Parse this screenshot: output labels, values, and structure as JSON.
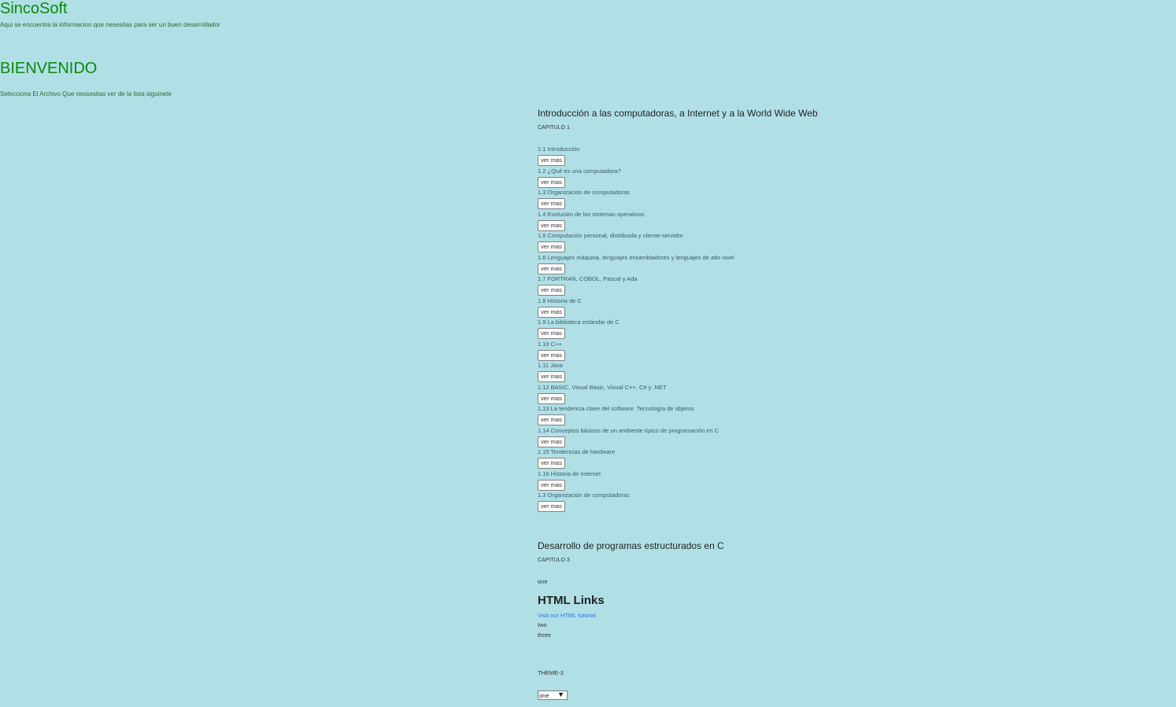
{
  "header": {
    "brand": "SincoSoft",
    "tagline": "Aqui se encuentra la informacion que nesesitas para ser un buen desarrollador"
  },
  "intro": {
    "welcome": "BIENVENIDO",
    "instruction": "Selecciona El Archivo Que nessesitas ver de la lista siguinete"
  },
  "chapter1": {
    "title": "Introducción a las computadoras, a Internet y a la World Wide Web",
    "label": "CAPITULO 1",
    "button_label": "ver mas",
    "topics": [
      "1.1 Introducción",
      "1.2 ¿Qué es una computadora?",
      "1.3 Organización de computadoras",
      "1.4 Evolución de los sistemas operativos",
      "1.5 Computación personal, distribuida y cliente-servidor",
      "1.6 Lenguajes máquina, lenguajes ensambladores y lenguajes de alto nivel",
      "1.7 FORTRAN, COBOL, Pascal y Ada",
      "1.8 Historia de C",
      "1.9 La biblioteca estándar de C",
      "1.10 C++",
      "1.11 Java",
      "1.12 BASIC, Visual Basic, Visual C++, C# y .NET",
      "1.13 La tendencia clave del software: Tecnología de objetos",
      "1.14 Conceptos básicos de un ambiente típico de programación en C",
      "1.15 Tendencias de hardware",
      "1.16 Historia de Internet",
      "1.3 Organización de computadoras"
    ]
  },
  "chapter3": {
    "title": "Desarrollo de programas estructurados en C",
    "label": "CAPITULO 3",
    "item_one": "one",
    "links_title": "HTML Links",
    "link_text": "Visit our HTML tutorial",
    "item_two": "two",
    "item_three": "three"
  },
  "theme": {
    "label": "THEME-3",
    "select_value": "one"
  }
}
